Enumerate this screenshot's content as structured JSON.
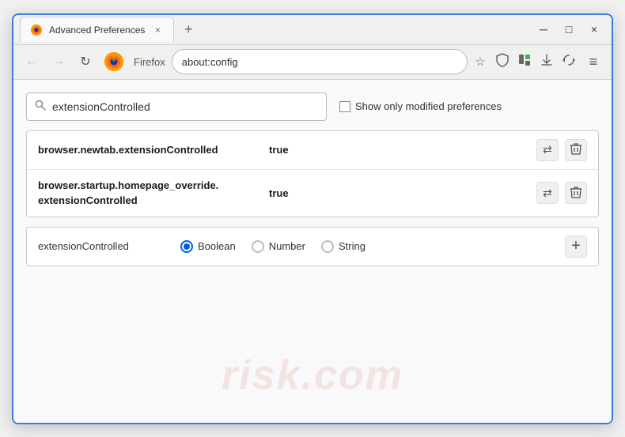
{
  "window": {
    "title": "Advanced Preferences",
    "tab_close": "×",
    "new_tab": "+",
    "min": "─",
    "max": "□",
    "close": "×"
  },
  "nav": {
    "back": "←",
    "forward": "→",
    "refresh": "↻",
    "browser_name": "Firefox",
    "url": "about:config",
    "bookmark": "☆",
    "shield": "⛉",
    "extension": "🧩",
    "menu": "≡"
  },
  "search": {
    "placeholder": "extensionControlled",
    "value": "extensionControlled",
    "show_modified_label": "Show only modified preferences"
  },
  "results": [
    {
      "name": "browser.newtab.extensionControlled",
      "value": "true"
    },
    {
      "name": "browser.startup.homepage_override.\nextensionControlled",
      "name_line1": "browser.startup.homepage_override.",
      "name_line2": "extensionControlled",
      "value": "true",
      "multiline": true
    }
  ],
  "add_row": {
    "name": "extensionControlled",
    "types": [
      "Boolean",
      "Number",
      "String"
    ],
    "selected_type": "Boolean",
    "add_btn": "+"
  },
  "watermark": "risk.com",
  "actions": {
    "reset": "⇄",
    "delete": "🗑"
  }
}
